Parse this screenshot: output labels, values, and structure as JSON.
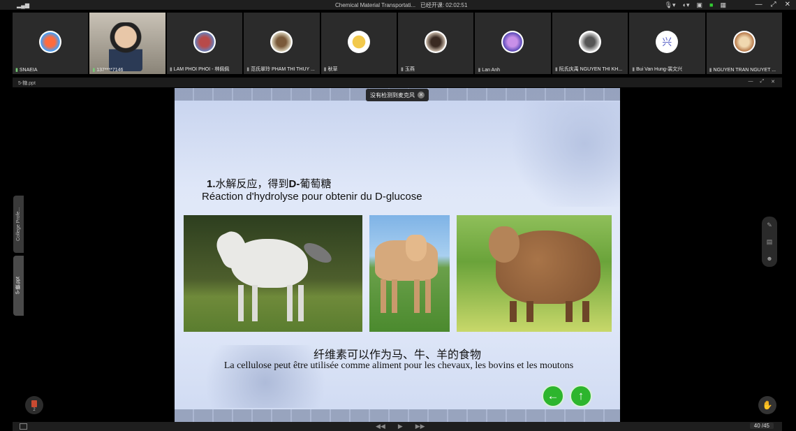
{
  "window": {
    "title": "Chemical Material Transportati...",
    "timer": "已经开课: 02:02:51",
    "signal_icon": "signal-icon",
    "controls": [
      "minimize",
      "restore",
      "close"
    ]
  },
  "participants": [
    {
      "name": "SNAEIA",
      "avatar": "balloon"
    },
    {
      "name": "137****7146",
      "avatar": "video"
    },
    {
      "name": "LAM PHOI PHOI - 林佩佩",
      "avatar": "girl"
    },
    {
      "name": "范氏翠玲 PHAM THI THUY ...",
      "avatar": "cartoon"
    },
    {
      "name": "秋草",
      "avatar": "chick"
    },
    {
      "name": "玉燕",
      "avatar": "woman"
    },
    {
      "name": "Lan Anh",
      "avatar": "anime"
    },
    {
      "name": "阮氏庆禹 NGUYEN THI KH...",
      "avatar": "person"
    },
    {
      "name": "Bui Van Hung-裴文兴",
      "avatar": "兴"
    },
    {
      "name": "NGUYEN TRAN NGUYET ...",
      "avatar": "cat"
    }
  ],
  "file": {
    "name": "5-糖.ppt"
  },
  "tooltip": {
    "text": "没有检测到麦克风"
  },
  "slide": {
    "heading_num": "1.",
    "heading_zh": "水解反应，得到",
    "heading_bold": "D-",
    "heading_zh2": "葡萄糖",
    "heading_fr": "Réaction d'hydrolyse pour obtenir du D-glucose",
    "caption_zh": "纤维素可以作为马、牛、羊的食物",
    "caption_fr": "La cellulose peut être utilisée comme aliment pour les chevaux, les bovins et les moutons",
    "nav_back": "←",
    "nav_up": "↑"
  },
  "side_tabs": [
    "College Profe...",
    "5-糖.ppt"
  ],
  "footer": {
    "page": "40 /45",
    "ppt_count": "2"
  }
}
